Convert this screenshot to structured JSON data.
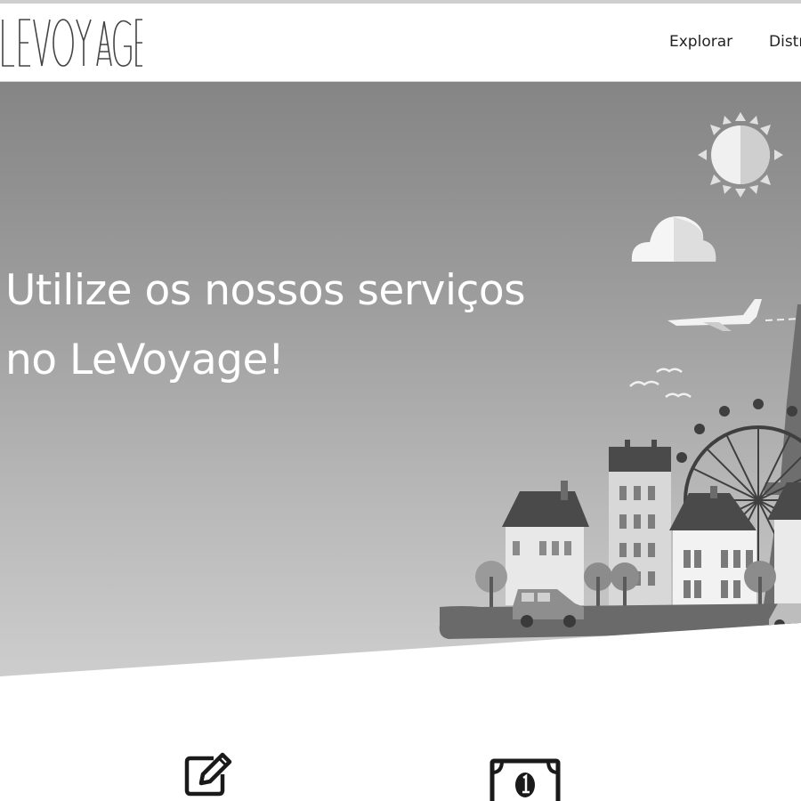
{
  "navbar": {
    "logo_text": "LEVOYAGE",
    "links": [
      {
        "label": "Explorar"
      },
      {
        "label": "Distr"
      }
    ]
  },
  "hero": {
    "title": "Utilize os nossos serviços no LeVoyage!",
    "illustration_icons": [
      "sun-icon",
      "cloud-icon",
      "airplane-icon",
      "birds-icon",
      "ferris-wheel-icon",
      "eiffel-tower-icon",
      "houses-icon",
      "car-icon",
      "trees-icon"
    ]
  },
  "services": {
    "icons": [
      "edit-icon",
      "money-bill-icon"
    ]
  },
  "colors": {
    "hero_gradient_top": "#858585",
    "hero_gradient_bottom": "#cdcdcd",
    "text_white": "#ffffff",
    "nav_text": "#222222"
  }
}
